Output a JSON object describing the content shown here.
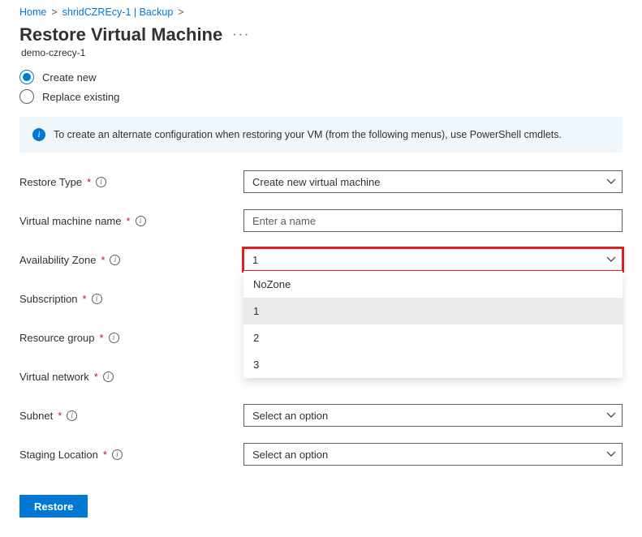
{
  "breadcrumb": {
    "items": [
      "Home",
      "shridCZREcy-1 | Backup"
    ]
  },
  "page": {
    "title": "Restore Virtual Machine",
    "subtitle": "demo-czrecy-1"
  },
  "radio": {
    "create_new": "Create new",
    "replace_existing": "Replace existing"
  },
  "info": {
    "text": "To create an alternate configuration when restoring your VM (from the following menus), use PowerShell cmdlets."
  },
  "form": {
    "restore_type": {
      "label": "Restore Type",
      "value": "Create new virtual machine"
    },
    "vm_name": {
      "label": "Virtual machine name",
      "placeholder": "Enter a name"
    },
    "availability_zone": {
      "label": "Availability Zone",
      "value": "1",
      "options": [
        "NoZone",
        "1",
        "2",
        "3"
      ]
    },
    "subscription": {
      "label": "Subscription"
    },
    "resource_group": {
      "label": "Resource group"
    },
    "virtual_network": {
      "label": "Virtual network"
    },
    "subnet": {
      "label": "Subnet",
      "value": "Select an option"
    },
    "staging_location": {
      "label": "Staging Location",
      "value": "Select an option"
    }
  },
  "actions": {
    "restore": "Restore"
  }
}
